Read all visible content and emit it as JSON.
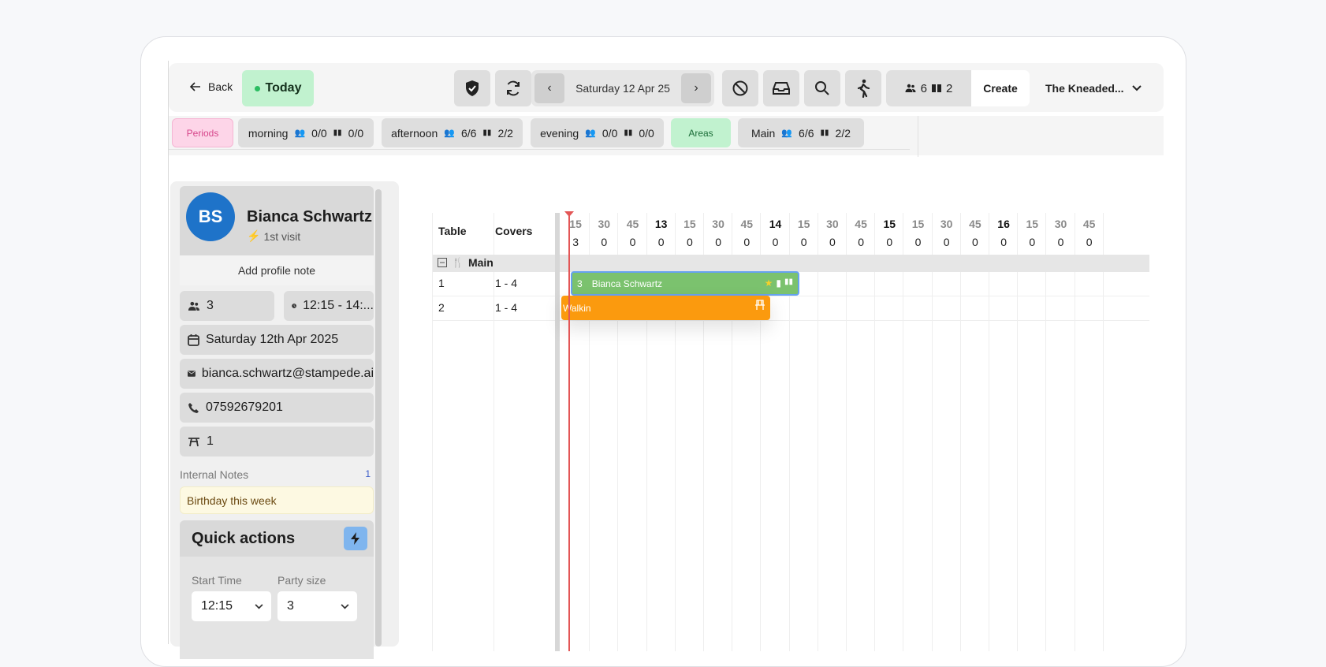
{
  "toolbar": {
    "back_label": "Back",
    "today_label": "Today",
    "date_label": "Saturday 12 Apr 25",
    "covers_count": "6",
    "bookings_count": "2",
    "create_label": "Create",
    "venue_label": "The Kneaded..."
  },
  "periods": {
    "periods_label": "Periods",
    "items": [
      {
        "name": "morning",
        "covers": "0/0",
        "tables": "0/0"
      },
      {
        "name": "afternoon",
        "covers": "6/6",
        "tables": "2/2"
      },
      {
        "name": "evening",
        "covers": "0/0",
        "tables": "0/0"
      }
    ],
    "areas_label": "Areas",
    "area": {
      "name": "Main",
      "covers": "6/6",
      "tables": "2/2"
    }
  },
  "guest": {
    "initials": "BS",
    "name": "Bianca Schwartz",
    "visit": "1st visit",
    "add_note_label": "Add profile note",
    "party_size": "3",
    "time": "12:15 - 14:...",
    "date": "Saturday 12th Apr 2025",
    "email": "bianca.schwartz@stampede.ai",
    "phone": "07592679201",
    "table": "1",
    "internal_notes_label": "Internal Notes",
    "internal_notes_count": "1",
    "note": "Birthday this week"
  },
  "quick_actions": {
    "title": "Quick actions",
    "start_time_label": "Start Time",
    "start_time_value": "12:15",
    "party_size_label": "Party size",
    "party_size_value": "3"
  },
  "grid": {
    "table_header": "Table",
    "covers_header": "Covers",
    "time_ticks": [
      "15",
      "30",
      "45",
      "13",
      "15",
      "30",
      "45",
      "14",
      "15",
      "30",
      "45",
      "15",
      "15",
      "30",
      "45",
      "16",
      "15",
      "30",
      "45"
    ],
    "cover_counts": [
      "3",
      "0",
      "0",
      "0",
      "0",
      "0",
      "0",
      "0",
      "0",
      "0",
      "0",
      "0",
      "0",
      "0",
      "0",
      "0",
      "0",
      "0",
      "0"
    ],
    "section_label": "Main",
    "rows": [
      {
        "table": "1",
        "covers": "1 - 4"
      },
      {
        "table": "2",
        "covers": "1 - 4"
      }
    ],
    "booking": {
      "covers": "3",
      "name": "Bianca Schwartz"
    },
    "walkin_label": "Walkin"
  },
  "colors": {
    "today_bg": "#c1f2cf",
    "avatar": "#1e73c9",
    "booking_green": "#7bc26e",
    "walkin_orange": "#fb9a0e",
    "now_line": "#e35656"
  }
}
